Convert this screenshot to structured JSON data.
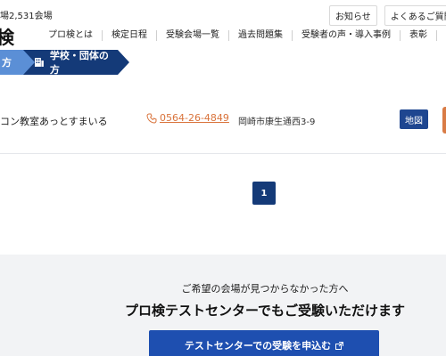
{
  "header": {
    "venue_count": "場2,531会場",
    "logo_fragment": "検",
    "utility_links": [
      "お知らせ",
      "よくあるご質問"
    ],
    "nav": [
      "プロ検とは",
      "検定日程",
      "受験会場一覧",
      "過去問題集",
      "受験者の声・導入事例",
      "表彰",
      "プ"
    ]
  },
  "tabs": {
    "individual_fragment": "方",
    "school_label": "学校・団体の方",
    "colors": {
      "individual": "#5b8fd6",
      "school": "#143a78"
    }
  },
  "listing": {
    "name": "コン教室あっとすまいる",
    "phone": "0564-26-4849",
    "address": "岡崎市康生通西3-9",
    "map_label": "地図"
  },
  "pagination": {
    "current": "1"
  },
  "cta": {
    "lead": "ご希望の会場が見つからなかった方へ",
    "title": "プロ検テストセンターでもご受験いただけます",
    "button_label": "テストセンターでの受験を申込む"
  }
}
